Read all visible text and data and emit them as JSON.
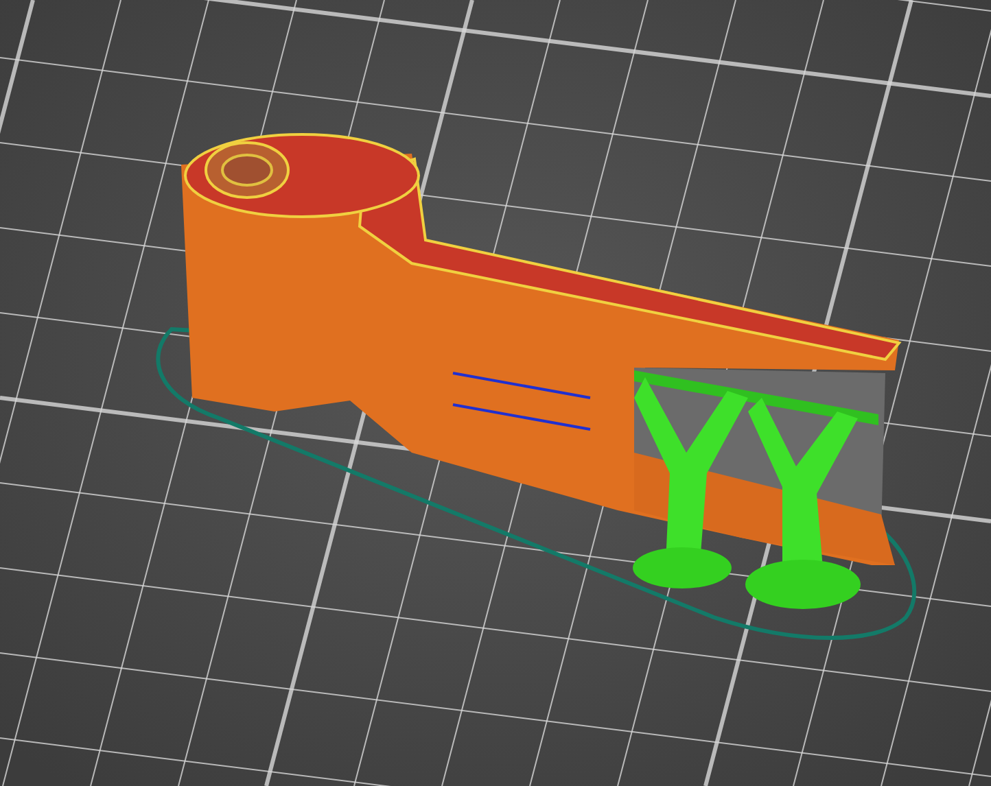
{
  "viewport": {
    "grid": true,
    "skirt": true,
    "supports": true
  }
}
